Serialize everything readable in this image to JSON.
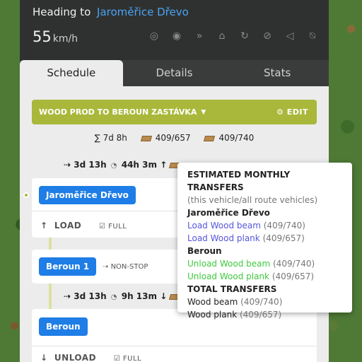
{
  "header": {
    "heading_label": "Heading to",
    "destination": "Jaroměřice Dřevo",
    "speed_value": "55",
    "speed_unit": "km/h",
    "icons": [
      "target-icon",
      "eye-icon",
      "skip-icon",
      "depot-icon",
      "refresh-icon",
      "no-service-icon",
      "horn-icon",
      "alarm-off-icon"
    ]
  },
  "tabs": [
    {
      "label": "Schedule",
      "active": true
    },
    {
      "label": "Details",
      "active": false
    },
    {
      "label": "Stats",
      "active": false
    }
  ],
  "schedule": {
    "title": "WOOD PROD TO BEROUN ZASTÁVKA",
    "edit_label": "EDIT",
    "total_time": "∑ 7d 8h",
    "total_beam": "409/657",
    "total_plank": "409/740",
    "segment1": {
      "t1": "3d 13h",
      "t2": "44h 3m"
    },
    "segment2": {
      "t1": "3d 13h",
      "t2": "9h 13m"
    },
    "stops": [
      {
        "name": "Jaroměřice Dřevo",
        "action": "LOAD",
        "mode": "FULL"
      },
      {
        "name": "Beroun 1",
        "note": "NON-STOP"
      },
      {
        "name": "Beroun",
        "action": "UNLOAD",
        "mode": "FULL"
      }
    ]
  },
  "tooltip": {
    "title": "ESTIMATED MONTHLY TRANSFERS",
    "subtitle": "(this vehicle/all route vehicles)",
    "station1": "Jaroměřice Dřevo",
    "load1": "Load Wood beam",
    "load1_val": "(409/740)",
    "load2": "Load Wood plank",
    "load2_val": "(409/657)",
    "station2": "Beroun",
    "unload1": "Unload Wood beam",
    "unload1_val": "(409/740)",
    "unload2": "Unload Wood plank",
    "unload2_val": "(409/657)",
    "total_title": "TOTAL TRANSFERS",
    "total1": "Wood beam",
    "total1_val": "(409/740)",
    "total2": "Wood plank",
    "total2_val": "(409/657)"
  },
  "colors": {
    "accent_olive": "#a9b83a",
    "stop_blue": "#1e7de6",
    "link_blue": "#4aa3f5"
  }
}
